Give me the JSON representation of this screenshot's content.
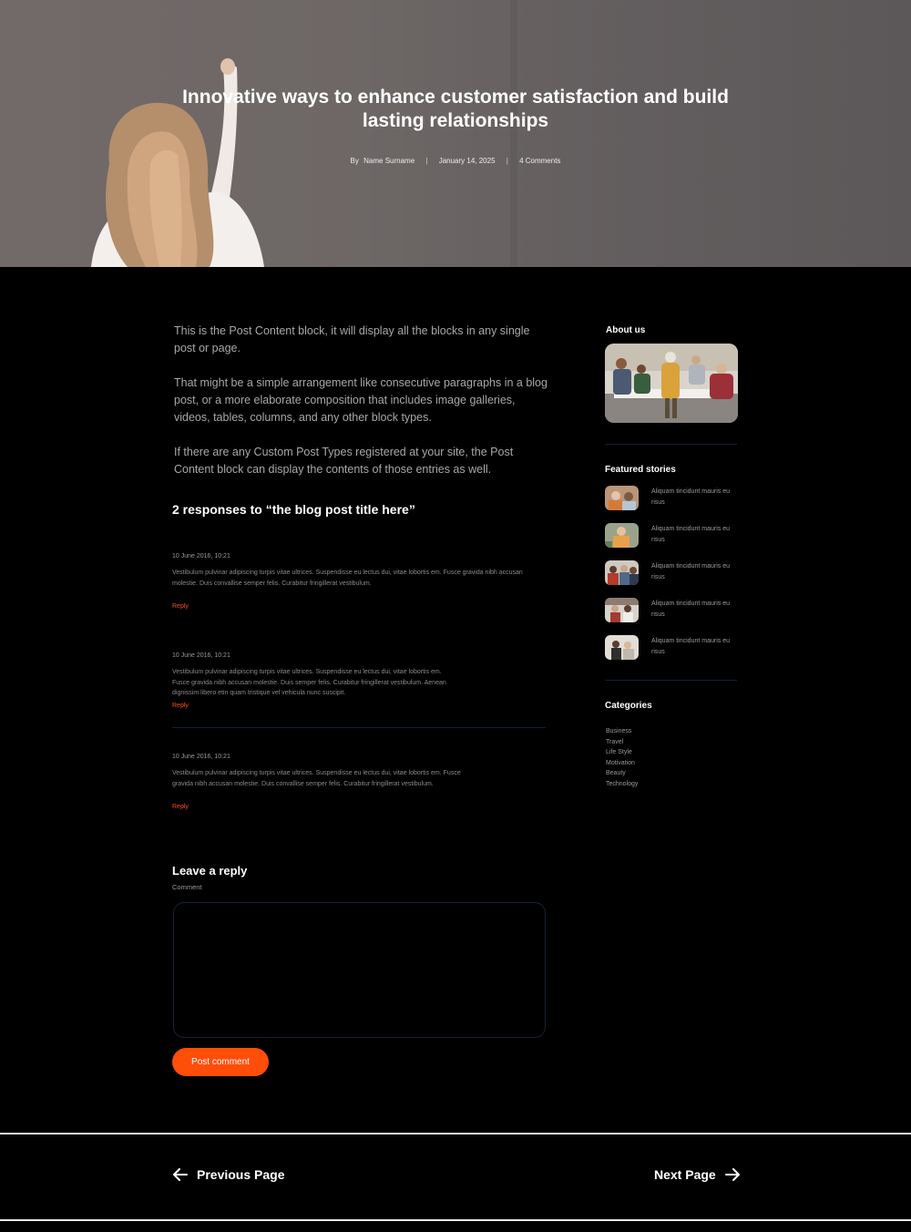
{
  "hero": {
    "title": "Innovative ways to enhance customer satisfaction and build lasting relationships",
    "by": "By",
    "author": "Name Surname",
    "date": "January 14, 2025",
    "comments": "4 Comments",
    "separator": "|"
  },
  "post": {
    "paragraphs": [
      "This is the Post Content block, it will display all the blocks in any single post or page.",
      "That might be a simple arrangement like consecutive paragraphs in a blog post, or a more elaborate composition that includes image galleries, videos, tables, columns, and any other block types.",
      "If there are any Custom Post Types registered at your site, the Post Content block can display the contents of those entries as well."
    ]
  },
  "responses": {
    "title": "2 responses to “the blog post title here”",
    "items": [
      {
        "date": "10 June 2016, 10:21",
        "text": "Vestibulum pulvinar adipiscing turpis vitae ultrices. Suspendisse eu lectus dui, vitae lobortis em. Fusce gravida nibh accusan molestie. Duis convallise semper felis. Curabitur fringillerat vestibulum.",
        "reply": "Reply"
      },
      {
        "date": "10 June 2016, 10:21",
        "text": "Vestibulum pulvinar adipiscing turpis vitae ultrices. Suspendisse eu lectus dui, vitae lobortis em. Fusce gravida nibh accusan molestie. Duis semper felis. Curabitur fringillerat vestibulum. Aenean dignissim libero etin quam tristique vel vehicula nunc suscipit.",
        "reply": "Reply"
      },
      {
        "date": "10 June 2016, 10:21",
        "text": "Vestibulum pulvinar adipiscing turpis vitae ultrices. Suspendisse eu lectus dui, vitae lobortis em. Fusce gravida nibh accusan molestie. Duis convallise semper felis. Curabitur fringillerat vestibulum.",
        "reply": "Reply"
      }
    ]
  },
  "reply_form": {
    "title": "Leave a reply",
    "label": "Comment",
    "button": "Post comment"
  },
  "sidebar": {
    "about_title": "About us",
    "featured_title": "Featured stories",
    "stories": [
      "Aliquam tincidunt mauris eu risus",
      "Aliquam tincidunt mauris eu risus",
      "Aliquam tincidunt mauris eu risus",
      "Aliquam tincidunt mauris eu risus",
      "Aliquam tincidunt mauris eu risus"
    ],
    "categories_title": "Categories",
    "categories": [
      "Business",
      "Travel",
      "Life Style",
      "Motivation",
      "Beauty",
      "Technology"
    ]
  },
  "nav": {
    "previous": "Previous Page",
    "next": "Next Page"
  },
  "colors": {
    "accent": "#ff4d0a",
    "background": "#000000",
    "divider": "#142035"
  }
}
